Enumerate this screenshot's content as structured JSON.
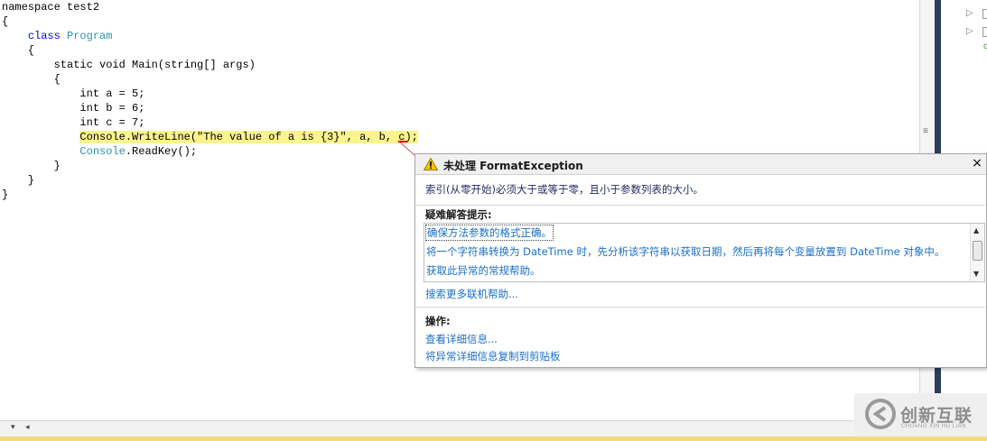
{
  "editor": {
    "lines": [
      {
        "segments": [
          {
            "t": "namespace test2",
            "c": "plain"
          }
        ]
      },
      {
        "segments": [
          {
            "t": "{",
            "c": "plain"
          }
        ]
      },
      {
        "segments": [
          {
            "t": "    ",
            "c": "plain"
          },
          {
            "t": "class",
            "c": "kw"
          },
          {
            "t": " ",
            "c": "plain"
          },
          {
            "t": "Program",
            "c": "ty"
          }
        ]
      },
      {
        "segments": [
          {
            "t": "    {",
            "c": "plain"
          }
        ]
      },
      {
        "segments": [
          {
            "t": "        ",
            "c": "plain"
          },
          {
            "t": "static void Main(string[] args)",
            "c": "plain"
          }
        ]
      },
      {
        "segments": [
          {
            "t": "        {",
            "c": "plain"
          }
        ]
      },
      {
        "segments": [
          {
            "t": "            ",
            "c": "plain"
          },
          {
            "t": "int a = 5;",
            "c": "plain"
          }
        ]
      },
      {
        "segments": [
          {
            "t": "            ",
            "c": "plain"
          },
          {
            "t": "int b = 6;",
            "c": "plain"
          }
        ]
      },
      {
        "segments": [
          {
            "t": "            ",
            "c": "plain"
          },
          {
            "t": "int c = 7;",
            "c": "plain"
          }
        ]
      },
      {
        "segments": [
          {
            "t": "            ",
            "c": "plain"
          },
          {
            "t": "Console.WriteLine(\"The value of a is {3}\", a, b, c);",
            "c": "highlight"
          }
        ]
      },
      {
        "segments": [
          {
            "t": "            ",
            "c": "plain"
          },
          {
            "t": "Console",
            "c": "ty"
          },
          {
            "t": ".ReadKey();",
            "c": "plain"
          }
        ]
      },
      {
        "segments": [
          {
            "t": "        }",
            "c": "plain"
          }
        ]
      },
      {
        "segments": [
          {
            "t": "    }",
            "c": "plain"
          }
        ]
      },
      {
        "segments": [
          {
            "t": "}",
            "c": "plain"
          }
        ]
      }
    ]
  },
  "exception": {
    "title": "未处理 FormatException",
    "message": "索引(从零开始)必须大于或等于零，且小于参数列表的大小。",
    "tips_heading": "疑难解答提示:",
    "tips": [
      "确保方法参数的格式正确。",
      "将一个字符串转换为 DateTime 时，先分析该字符串以获取日期，然后再将每个变量放置到 DateTime 对象中。",
      "获取此异常的常规帮助。"
    ],
    "search_link": "搜索更多联机帮助...",
    "actions_heading": "操作:",
    "actions": [
      "查看详细信息...",
      "将异常详细信息复制到剪贴板"
    ],
    "close_glyph": "×"
  },
  "watermark": {
    "main": "创新互联",
    "sub": "CHUANG XIN HU LIAN"
  },
  "colors": {
    "keyword": "#0000ff",
    "type": "#2b91af",
    "highlight": "#fbf38c",
    "link": "#1a6fc4",
    "warning": "#f5c400"
  },
  "icons": {
    "exception": "warning-triangle-icon",
    "close": "close-icon"
  }
}
